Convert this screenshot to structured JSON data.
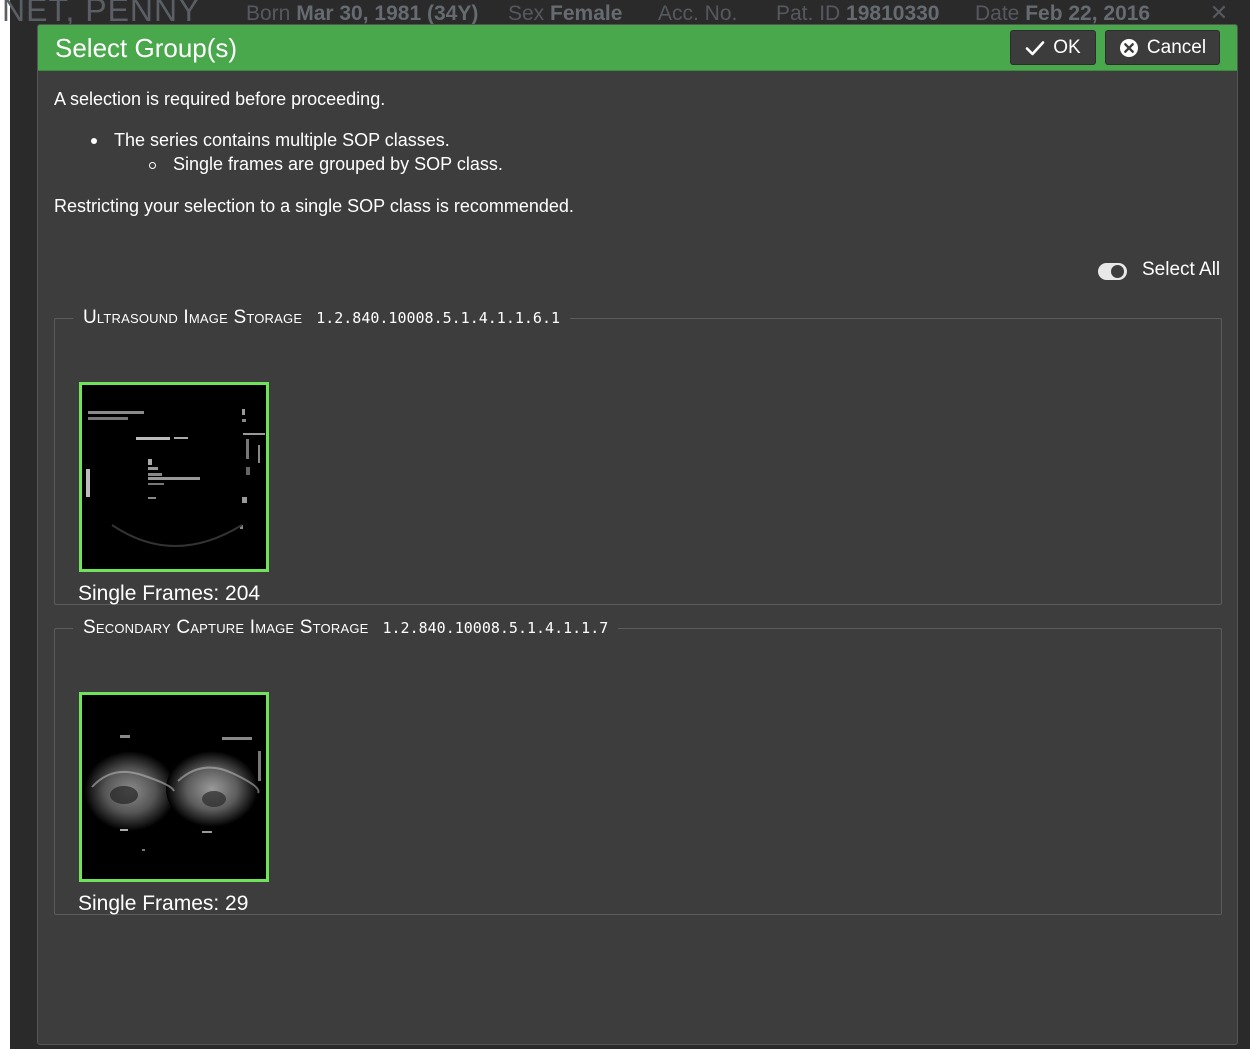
{
  "patient_bar": {
    "name_fragment": "NET, PENNY",
    "born_label": "Born",
    "born_value": "Mar 30, 1981 (34Y)",
    "sex_label": "Sex",
    "sex_value": "Female",
    "acc_label": "Acc. No.",
    "pat_id_label": "Pat. ID",
    "pat_id_value": "19810330",
    "date_label": "Date",
    "date_value": "Feb 22, 2016",
    "close_glyph": "✕"
  },
  "dialog": {
    "title": "Select Group(s)",
    "ok_label": "OK",
    "cancel_label": "Cancel",
    "message_intro": "A selection is required before proceeding.",
    "bullet_1": "The series contains multiple SOP classes.",
    "bullet_2": "Single frames are grouped by SOP class.",
    "recommendation": "Restricting your selection to a single SOP class is recommended.",
    "select_all_label": "Select All",
    "select_all_on": true,
    "accent_color": "#4aa84c",
    "selected_border_color": "#6fe35a",
    "groups": [
      {
        "sop_name": "Ultrasound Image Storage",
        "sop_uid": "1.2.840.10008.5.1.4.1.1.6.1",
        "frames_label": "Single Frames: 204",
        "selected": true
      },
      {
        "sop_name": "Secondary Capture Image Storage",
        "sop_uid": "1.2.840.10008.5.1.4.1.1.7",
        "frames_label": "Single Frames: 29",
        "selected": true
      }
    ]
  }
}
